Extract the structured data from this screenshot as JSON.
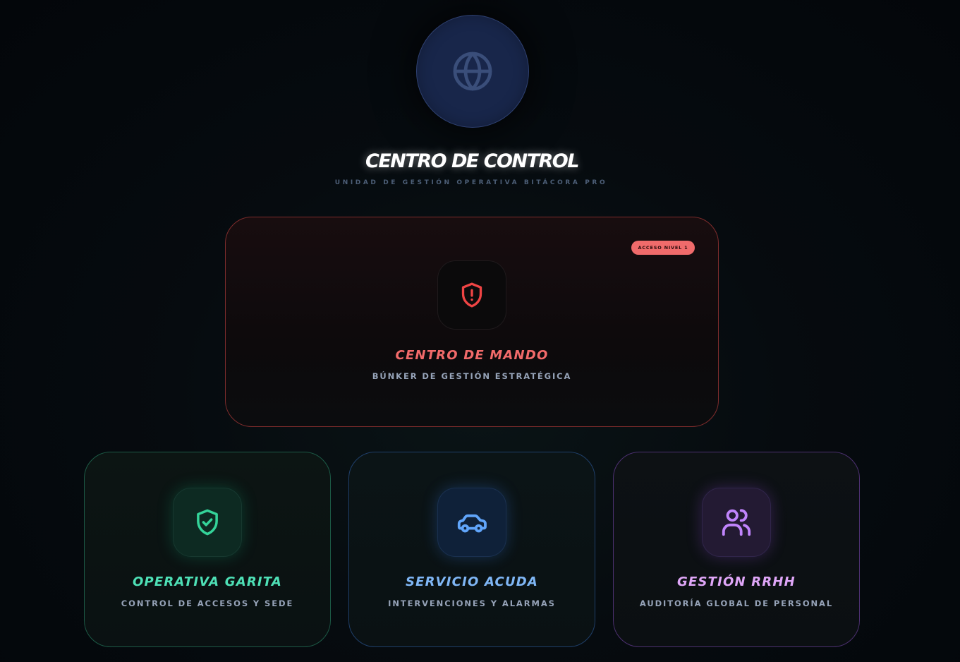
{
  "header": {
    "logo_icon": "globe-icon",
    "title": "CENTRO DE CONTROL",
    "subtitle": "UNIDAD DE GESTIÓN OPERATIVA BITÁCORA PRO"
  },
  "main_card": {
    "badge": "ACCESO NIVEL 1",
    "icon": "shield-alert-icon",
    "title": "CENTRO DE MANDO",
    "description": "BÚNKER DE GESTIÓN ESTRATÉGICA",
    "accent": "#f26a6a"
  },
  "cards": [
    {
      "icon": "shield-check-icon",
      "title": "OPERATIVA GARITA",
      "description": "CONTROL DE ACCESOS Y SEDE",
      "accent": "#34d399"
    },
    {
      "icon": "car-icon",
      "title": "SERVICIO ACUDA",
      "description": "INTERVENCIONES Y ALARMAS",
      "accent": "#60a5fa"
    },
    {
      "icon": "users-icon",
      "title": "GESTIÓN RRHH",
      "description": "AUDITORÍA GLOBAL DE PERSONAL",
      "accent": "#c084fc"
    }
  ]
}
